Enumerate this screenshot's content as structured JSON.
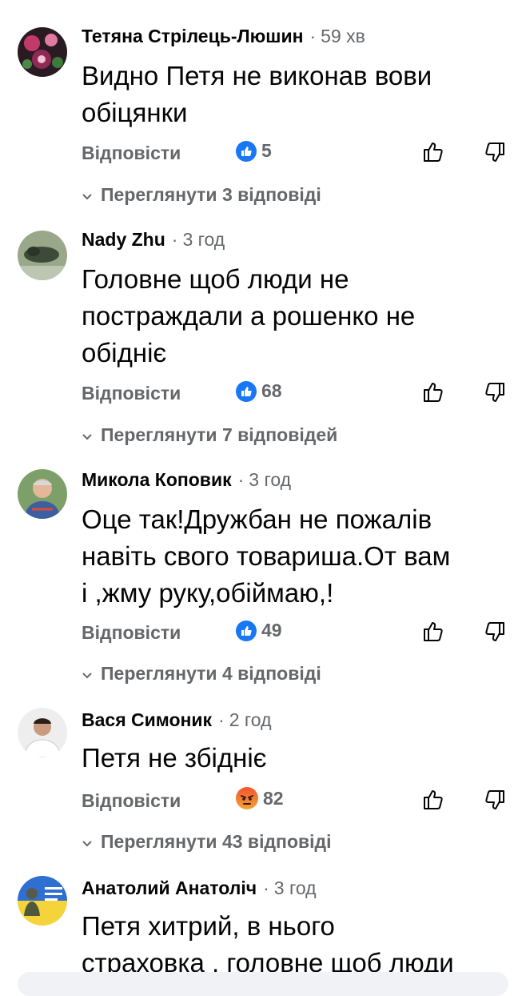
{
  "comments": [
    {
      "author": "Тетяна Стрілець-Люшин",
      "separator": "·",
      "time": "59 хв",
      "text_lines": [
        "Видно Петя не виконав вови",
        "обіцянки"
      ],
      "reply_label": "Відповісти",
      "reaction_type": "like",
      "reaction_count": "5",
      "view_replies": "Переглянути 3 відповіді"
    },
    {
      "author": "Nady Zhu",
      "separator": "·",
      "time": "3 год",
      "text_lines": [
        "Головне щоб люди не",
        "постраждали а рошенко не",
        "обідніє"
      ],
      "reply_label": "Відповісти",
      "reaction_type": "like",
      "reaction_count": "68",
      "view_replies": "Переглянути 7 відповідей"
    },
    {
      "author": "Микола Коповик",
      "separator": "·",
      "time": "3 год",
      "text_lines": [
        "Оце так!Дружбан не пожалів",
        "навіть свого товариша.От вам",
        "і ,жму руку,обіймаю,!"
      ],
      "reply_label": "Відповісти",
      "reaction_type": "like",
      "reaction_count": "49",
      "view_replies": "Переглянути 4 відповіді"
    },
    {
      "author": "Вася Симоник",
      "separator": "·",
      "time": "2 год",
      "text_lines": [
        "Петя не збідніє"
      ],
      "reply_label": "Відповісти",
      "reaction_type": "angry",
      "reaction_count": "82",
      "view_replies": "Переглянути 43 відповіді"
    },
    {
      "author": "Анатолий Анатоліч",
      "separator": "·",
      "time": "3 год",
      "text_lines": [
        "Петя хитрий, в нього",
        "страховка , головне щоб люди"
      ]
    }
  ],
  "icons": {
    "like_reaction": "like-reaction-icon",
    "angry_reaction": "angry-reaction-icon",
    "thumb_up": "thumb-up-icon",
    "thumb_down": "thumb-down-icon",
    "chevron": "chevron-down-icon"
  },
  "colors": {
    "secondary_text": "#65676b",
    "like_blue": "#1877f2",
    "primary_text": "#050505"
  }
}
